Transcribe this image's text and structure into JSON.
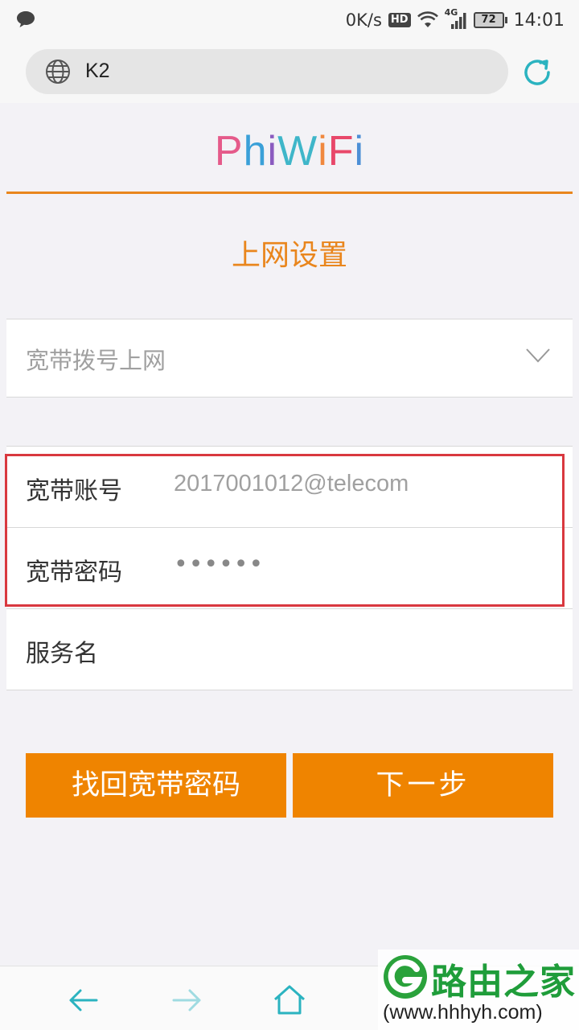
{
  "status_bar": {
    "speed": "0K/s",
    "hd_badge": "HD",
    "network": "4G",
    "battery": "72",
    "time": "14:01"
  },
  "browser": {
    "url": "K2"
  },
  "page": {
    "logo": {
      "letters": [
        "P",
        "h",
        "i",
        "W",
        "i",
        "F",
        "i"
      ],
      "colors": [
        "#e55a8a",
        "#3aa0d8",
        "#8b5bbf",
        "#3fb6c9",
        "#f0883e",
        "#e8486a",
        "#4c8fd6"
      ]
    },
    "title": "上网设置",
    "connection_type": "宽带拨号上网",
    "form": {
      "account_label": "宽带账号",
      "account_value": "2017001012@telecom",
      "password_label": "宽带密码",
      "password_value": "••••••",
      "service_label": "服务名"
    },
    "buttons": {
      "recover_password": "找回宽带密码",
      "next": "下一步"
    },
    "accent_color": "#e9861d",
    "highlight_color": "#d9383f"
  },
  "watermark": {
    "name": "路由之家",
    "url": "(www.hhhyh.com)"
  },
  "bottom_nav": {
    "icons": [
      "back-arrow-icon",
      "forward-arrow-icon",
      "home-icon"
    ]
  }
}
